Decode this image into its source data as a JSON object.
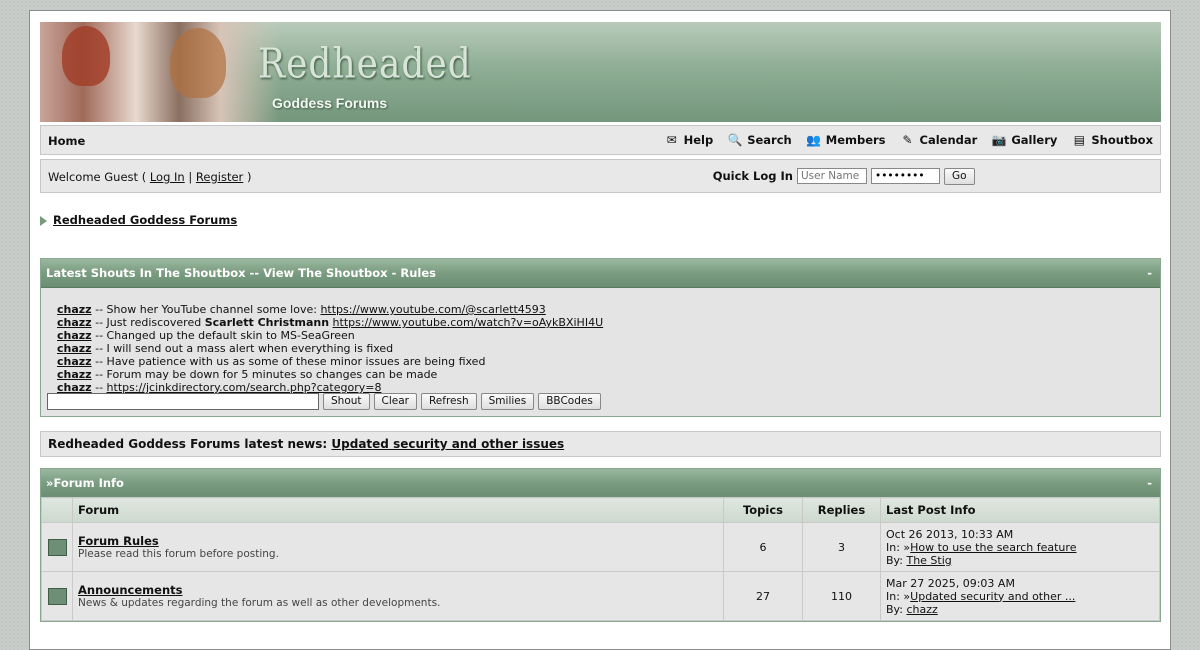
{
  "banner": {
    "title": "Redheaded",
    "subtitle": "Goddess Forums"
  },
  "nav": {
    "home": "Home",
    "links": [
      {
        "label": "Help",
        "icon": "✉"
      },
      {
        "label": "Search",
        "icon": "🔍"
      },
      {
        "label": "Members",
        "icon": "👥"
      },
      {
        "label": "Calendar",
        "icon": "✎"
      },
      {
        "label": "Gallery",
        "icon": "📷"
      },
      {
        "label": "Shoutbox",
        "icon": "▤"
      }
    ]
  },
  "welcome": {
    "prefix": "Welcome Guest (",
    "login": "Log In",
    "sep": "|",
    "register": "Register",
    "suffix": ")",
    "quick_label": "Quick Log In",
    "user_placeholder": "User Name",
    "pass_value": "••••••••",
    "go": "Go"
  },
  "breadcrumb": "Redheaded Goddess Forums",
  "shoutbox": {
    "title": "Latest Shouts In The Shoutbox -- View The Shoutbox - Rules",
    "collapse": "-",
    "shouts": [
      {
        "name": "chazz",
        "sep": "--",
        "text": "Show her YouTube channel some love:",
        "bold": "",
        "link": "https://www.youtube.com/@scarlett4593"
      },
      {
        "name": "chazz",
        "sep": "--",
        "text": "Just rediscovered",
        "bold": "Scarlett Christmann",
        "link": "https://www.youtube.com/watch?v=oAykBXiHI4U"
      },
      {
        "name": "chazz",
        "sep": "--",
        "text": "Changed up the default skin to MS-SeaGreen",
        "bold": "",
        "link": ""
      },
      {
        "name": "chazz",
        "sep": "--",
        "text": "I will send out a mass alert when everything is fixed",
        "bold": "",
        "link": ""
      },
      {
        "name": "chazz",
        "sep": "--",
        "text": "Have patience with us as some of these minor issues are being fixed",
        "bold": "",
        "link": ""
      },
      {
        "name": "chazz",
        "sep": "--",
        "text": "Forum may be down for 5 minutes so changes can be made",
        "bold": "",
        "link": ""
      },
      {
        "name": "chazz",
        "sep": "--",
        "text": "",
        "bold": "",
        "link": "https://jcinkdirectory.com/search.php?category=8"
      }
    ],
    "buttons": [
      "Shout",
      "Clear",
      "Refresh",
      "Smilies",
      "BBCodes"
    ]
  },
  "news": {
    "label": "Redheaded Goddess Forums latest news:",
    "link": "Updated security and other issues"
  },
  "forum_info": {
    "title": "Forum Info",
    "collapse": "-",
    "columns": [
      "Forum",
      "Topics",
      "Replies",
      "Last Post Info"
    ],
    "rows": [
      {
        "name": "Forum Rules",
        "desc": "Please read this forum before posting.",
        "topics": "6",
        "replies": "3",
        "date": "Oct 26 2013, 10:33 AM",
        "in_label": "In:",
        "in_topic": "How to use the search feature",
        "by_label": "By:",
        "by": "The Stig"
      },
      {
        "name": "Announcements",
        "desc": "News & updates regarding the forum as well as other developments.",
        "topics": "27",
        "replies": "110",
        "date": "Mar 27 2025, 09:03 AM",
        "in_label": "In:",
        "in_topic": "Updated security and other ...",
        "by_label": "By:",
        "by": "chazz"
      }
    ]
  }
}
